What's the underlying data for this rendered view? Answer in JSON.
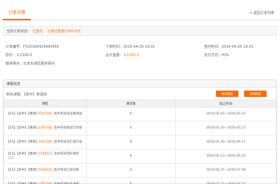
{
  "tabs": {
    "active": "订单详情",
    "back_link": "< 返回订单列表"
  },
  "status": {
    "label": "当前订单状态：",
    "value": "已签约",
    "extra": "订单已收款1500.0元"
  },
  "info": [
    [
      {
        "label": "订单编号：",
        "value": "FX20160429000456"
      },
      {
        "label": "下单时间：",
        "value": "2016-04-29 19:01"
      },
      {
        "label": "签约时间：",
        "value": "2016-04-29 19:01"
      }
    ],
    [
      {
        "label": "原价：",
        "value": "￥1500.0"
      },
      {
        "label": "合计金额：",
        "value": "￥1500.0",
        "orange": true
      },
      {
        "label": "支付方式：",
        "value": "POS"
      }
    ],
    [
      {
        "label": "服务网点：",
        "value": "北京东城区服务网点"
      }
    ]
  ],
  "panel": {
    "title": "课程信息",
    "toolbar_label": "购买课程：【高中】英语班",
    "btn1": "修改课程",
    "btn2": "新增课程",
    "headers": [
      "课程",
      "课次数",
      "起止时间"
    ]
  },
  "rows": [
    {
      "name": "【ZS】【高中】【精讲】",
      "code": "【00708】",
      "tail": "高中英语语法精讲班",
      "num": "6",
      "dates": "2016.05.03—2016.05.15"
    },
    {
      "name": "【ZS】【高中】【精讲】",
      "code": "【00708】",
      "tail": "高中英语阅读写作班",
      "num": "6",
      "dates": "2016.05.16—2016.05.27"
    },
    {
      "name": "【ZS】【高中】【精讲】",
      "code": "【00708】",
      "tail": "高中英语词汇提升班",
      "num": "6",
      "dates": "2016.05.30—2016.06.11"
    },
    {
      "name": "【ZS】【高中】【精讲】",
      "code": "【00851】",
      "tail": "高中英语完形填空（二）",
      "num": "6",
      "dates": "2016.06.13—2016.06.24"
    },
    {
      "name": "【ZS】【高中】【精讲】",
      "code": "【00604】",
      "tail": "高中英语口语训练",
      "num": "6",
      "dates": "2016.06.27—2016.07.08"
    },
    {
      "name": "【ZS】【高中】【精讲】",
      "code": "【00708】",
      "tail": "高中英语综合冲刺",
      "num": "6",
      "dates": "2016.07.11—2016.07.22"
    }
  ]
}
